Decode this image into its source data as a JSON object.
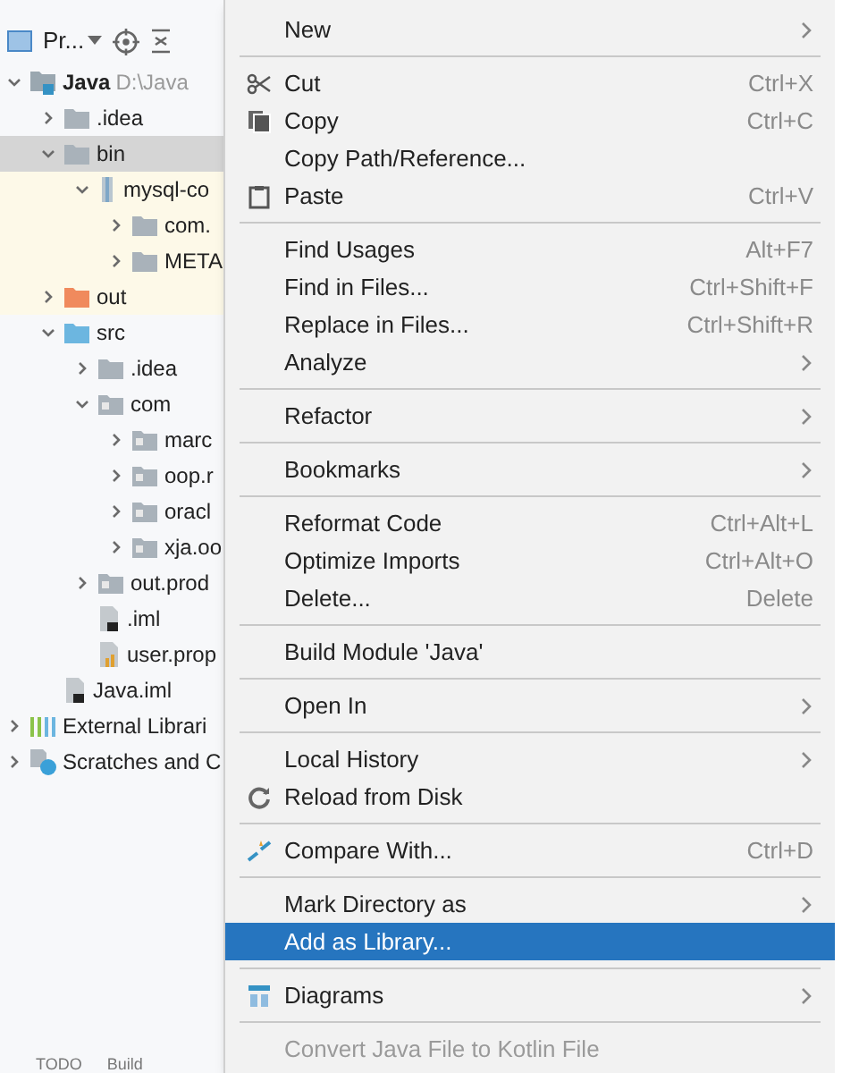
{
  "project_panel": {
    "title": "Pr...",
    "tree": [
      {
        "label": "Java",
        "path": "D:\\Java",
        "kind": "module",
        "expanded": true,
        "selected": false,
        "highlighted": false,
        "children": [
          {
            "label": ".idea",
            "kind": "folder",
            "expanded": false,
            "selected": false,
            "highlighted": false
          },
          {
            "label": "bin",
            "kind": "folder",
            "expanded": true,
            "selected": true,
            "highlighted": false,
            "children": [
              {
                "label": "mysql-co",
                "kind": "jar",
                "expanded": true,
                "selected": false,
                "highlighted": true,
                "children": [
                  {
                    "label": "com.",
                    "kind": "folder",
                    "expanded": false,
                    "selected": false,
                    "highlighted": true
                  },
                  {
                    "label": "META",
                    "kind": "folder",
                    "expanded": false,
                    "selected": false,
                    "highlighted": true
                  }
                ]
              }
            ]
          },
          {
            "label": "out",
            "kind": "excluded",
            "expanded": false,
            "selected": false,
            "highlighted": true
          },
          {
            "label": "src",
            "kind": "source",
            "expanded": true,
            "selected": false,
            "highlighted": false,
            "children": [
              {
                "label": ".idea",
                "kind": "folder",
                "expanded": false,
                "selected": false,
                "highlighted": false
              },
              {
                "label": "com",
                "kind": "package",
                "expanded": true,
                "selected": false,
                "highlighted": false,
                "children": [
                  {
                    "label": "marc",
                    "kind": "package",
                    "expanded": false,
                    "selected": false,
                    "highlighted": false
                  },
                  {
                    "label": "oop.r",
                    "kind": "package",
                    "expanded": false,
                    "selected": false,
                    "highlighted": false
                  },
                  {
                    "label": "oracl",
                    "kind": "package",
                    "expanded": false,
                    "selected": false,
                    "highlighted": false
                  },
                  {
                    "label": "xja.oo",
                    "kind": "package",
                    "expanded": false,
                    "selected": false,
                    "highlighted": false
                  }
                ]
              },
              {
                "label": "out.prod",
                "kind": "package",
                "expanded": false,
                "selected": false,
                "highlighted": false
              },
              {
                "label": ".iml",
                "kind": "file",
                "selected": false,
                "highlighted": false
              },
              {
                "label": "user.prop",
                "kind": "properties",
                "selected": false,
                "highlighted": false
              }
            ]
          },
          {
            "label": "Java.iml",
            "kind": "file",
            "selected": false,
            "highlighted": false
          }
        ]
      },
      {
        "label": "External Librari",
        "kind": "library",
        "expanded": false,
        "selected": false,
        "highlighted": false
      },
      {
        "label": "Scratches and C",
        "kind": "scratches",
        "expanded": false,
        "selected": false,
        "highlighted": false
      }
    ],
    "bottom_tabs": [
      "TODO",
      "Build"
    ]
  },
  "context_menu": {
    "groups": [
      [
        {
          "label": "New",
          "submenu": true,
          "selected": false,
          "disabled": false
        }
      ],
      [
        {
          "label": "Cut",
          "shortcut": "Ctrl+X",
          "submenu": false,
          "selected": false,
          "disabled": false
        },
        {
          "label": "Copy",
          "shortcut": "Ctrl+C",
          "submenu": false,
          "selected": false,
          "disabled": false
        },
        {
          "label": "Copy Path/Reference...",
          "submenu": false,
          "selected": false,
          "disabled": false
        },
        {
          "label": "Paste",
          "shortcut": "Ctrl+V",
          "submenu": false,
          "selected": false,
          "disabled": false
        }
      ],
      [
        {
          "label": "Find Usages",
          "shortcut": "Alt+F7",
          "submenu": false,
          "selected": false,
          "disabled": false
        },
        {
          "label": "Find in Files...",
          "shortcut": "Ctrl+Shift+F",
          "submenu": false,
          "selected": false,
          "disabled": false
        },
        {
          "label": "Replace in Files...",
          "shortcut": "Ctrl+Shift+R",
          "submenu": false,
          "selected": false,
          "disabled": false
        },
        {
          "label": "Analyze",
          "submenu": true,
          "selected": false,
          "disabled": false
        }
      ],
      [
        {
          "label": "Refactor",
          "submenu": true,
          "selected": false,
          "disabled": false
        }
      ],
      [
        {
          "label": "Bookmarks",
          "submenu": true,
          "selected": false,
          "disabled": false
        }
      ],
      [
        {
          "label": "Reformat Code",
          "shortcut": "Ctrl+Alt+L",
          "submenu": false,
          "selected": false,
          "disabled": false
        },
        {
          "label": "Optimize Imports",
          "shortcut": "Ctrl+Alt+O",
          "submenu": false,
          "selected": false,
          "disabled": false
        },
        {
          "label": "Delete...",
          "shortcut": "Delete",
          "submenu": false,
          "selected": false,
          "disabled": false
        }
      ],
      [
        {
          "label": "Build Module 'Java'",
          "submenu": false,
          "selected": false,
          "disabled": false
        }
      ],
      [
        {
          "label": "Open In",
          "submenu": true,
          "selected": false,
          "disabled": false
        }
      ],
      [
        {
          "label": "Local History",
          "submenu": true,
          "selected": false,
          "disabled": false
        },
        {
          "label": "Reload from Disk",
          "submenu": false,
          "selected": false,
          "disabled": false
        }
      ],
      [
        {
          "label": "Compare With...",
          "shortcut": "Ctrl+D",
          "submenu": false,
          "selected": false,
          "disabled": false
        }
      ],
      [
        {
          "label": "Mark Directory as",
          "submenu": true,
          "selected": false,
          "disabled": false
        },
        {
          "label": "Add as Library...",
          "submenu": false,
          "selected": true,
          "disabled": false
        }
      ],
      [
        {
          "label": "Diagrams",
          "submenu": true,
          "selected": false,
          "disabled": false
        }
      ],
      [
        {
          "label": "Convert Java File to Kotlin File",
          "submenu": false,
          "selected": false,
          "disabled": true
        }
      ]
    ]
  }
}
